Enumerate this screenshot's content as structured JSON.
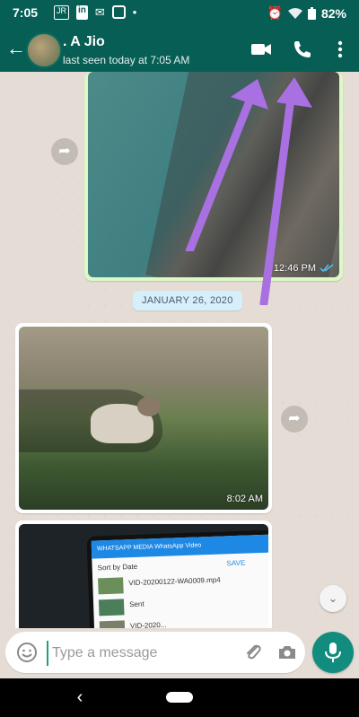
{
  "status_bar": {
    "time": "7:05",
    "battery": "82%",
    "left_icons": [
      "jio-icon",
      "linkedin-icon",
      "mail-icon",
      "instagram-icon",
      "dot-icon"
    ],
    "right_icons": [
      "alarm-icon",
      "wifi-icon",
      "battery-icon"
    ]
  },
  "header": {
    "contact_name": ". A Jio",
    "last_seen": "last seen today at 7:05 AM",
    "icons": [
      "back-arrow-icon",
      "video-call-icon",
      "voice-call-icon",
      "more-vert-icon"
    ],
    "accent": "#075e54"
  },
  "messages": [
    {
      "type": "image",
      "direction": "outgoing",
      "time": "12:46 PM",
      "status": "read"
    },
    {
      "type": "date_chip",
      "label": "JANUARY 26, 2020"
    },
    {
      "type": "image",
      "direction": "incoming",
      "time": "8:02 AM"
    },
    {
      "type": "image",
      "direction": "incoming",
      "preview": {
        "toolbar": "WHATSAPP  MEDIA  WhatsApp Video",
        "sort_label": "Sort by Date",
        "save_label": "SAVE",
        "file1": "VID-20200122-WA0009.mp4",
        "file2": "Sent",
        "file3": "VID-2020..."
      }
    }
  ],
  "composer": {
    "placeholder": "Type a message",
    "icons": [
      "emoji-icon",
      "attach-icon",
      "camera-icon",
      "mic-icon"
    ],
    "mic_color": "#128c7e"
  },
  "nav_bar": {
    "icons": [
      "nav-back-icon",
      "nav-home-pill"
    ]
  },
  "annotations": {
    "arrow_color": "#a870e0"
  }
}
